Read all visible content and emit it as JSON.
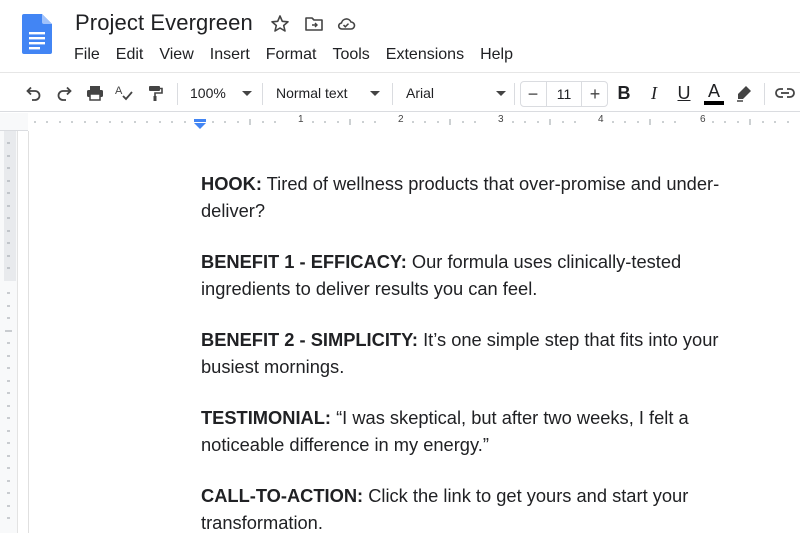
{
  "app": {
    "document_title": "Project Evergreen",
    "menus": [
      "File",
      "Edit",
      "View",
      "Insert",
      "Format",
      "Tools",
      "Extensions",
      "Help"
    ]
  },
  "toolbar": {
    "zoom": "100%",
    "paragraph_style": "Normal text",
    "font": "Arial",
    "font_size": "11",
    "minus": "−",
    "plus": "+",
    "bold_label": "B",
    "italic_label": "I",
    "underline_label": "U",
    "text_color_label": "A"
  },
  "ruler": {
    "numbers": [
      "1",
      "2",
      "3",
      "4",
      "6"
    ]
  },
  "document": {
    "paragraphs": [
      {
        "label": "HOOK:",
        "text": " Tired of wellness products that over-promise and under-deliver?"
      },
      {
        "label": "BENEFIT 1 - EFFICACY:",
        "text": " Our formula uses clinically-tested ingredients to deliver results you can feel."
      },
      {
        "label": "BENEFIT 2 - SIMPLICITY:",
        "text": " It’s one simple step that fits into your busiest mornings."
      },
      {
        "label": "TESTIMONIAL:",
        "text": " “I was skeptical, but after two weeks, I felt a noticeable difference in my energy.”"
      },
      {
        "label": "CALL-TO-ACTION:",
        "text": " Click the link to get yours and start your transformation."
      }
    ]
  },
  "colors": {
    "docs_blue": "#4285f4",
    "text": "#202124",
    "ruler_marker": "#4285f4"
  }
}
